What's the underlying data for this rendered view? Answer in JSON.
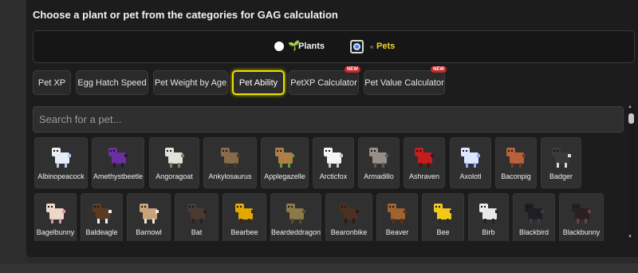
{
  "title": "Choose a plant or pet from the categories for GAG calculation",
  "mode": {
    "plants_label": "Plants",
    "pets_label": "Pets",
    "selected": "Pets"
  },
  "tabs": [
    {
      "label": "Pet XP",
      "badge": ""
    },
    {
      "label": "Egg Hatch Speed",
      "badge": ""
    },
    {
      "label": "Pet Weight by Age",
      "badge": ""
    },
    {
      "label": "Pet Ability",
      "badge": ""
    },
    {
      "label": "PetXP Calculator",
      "badge": "NEW"
    },
    {
      "label": "Pet Value Calculator",
      "badge": "NEW"
    }
  ],
  "active_tab": "Pet Ability",
  "search": {
    "placeholder": "Search for a pet...",
    "value": ""
  },
  "pets_row1": [
    {
      "name": "Albinopeacock",
      "color": "#e8eef5",
      "accent": "#b9c7ff"
    },
    {
      "name": "Amethystbeetle",
      "color": "#6a2fa0",
      "accent": "#2a1440"
    },
    {
      "name": "Angoragoat",
      "color": "#e4e1da",
      "accent": "#8a7a66"
    },
    {
      "name": "Ankylosaurus",
      "color": "#8a6a4c",
      "accent": "#4a3626"
    },
    {
      "name": "Applegazelle",
      "color": "#b07f48",
      "accent": "#5fa03a"
    },
    {
      "name": "Arcticfox",
      "color": "#f4f4f4",
      "accent": "#c9c9c9"
    },
    {
      "name": "Armadillo",
      "color": "#9a8f86",
      "accent": "#5e5752"
    },
    {
      "name": "Ashraven",
      "color": "#c31d1d",
      "accent": "#5a0b0b"
    },
    {
      "name": "Axolotl",
      "color": "#dce8ff",
      "accent": "#8fa9ff"
    },
    {
      "name": "Baconpig",
      "color": "#b8623c",
      "accent": "#7a3a20"
    },
    {
      "name": "Badger",
      "color": "#3a3a3a",
      "accent": "#dcdcdc"
    }
  ],
  "pets_row2": [
    {
      "name": "Bagelbunny",
      "color": "#ecd8c8",
      "accent": "#d49aa8"
    },
    {
      "name": "Baldeagle",
      "color": "#5a3b22",
      "accent": "#f2f2f2"
    },
    {
      "name": "Barnowl",
      "color": "#c9a47a",
      "accent": "#f0e6d6"
    },
    {
      "name": "Bat",
      "color": "#4a3a34",
      "accent": "#2b201c"
    },
    {
      "name": "Bearbee",
      "color": "#e0a800",
      "accent": "#3a2a10"
    },
    {
      "name": "Beardeddragon",
      "color": "#8a7a48",
      "accent": "#5a4e2c"
    },
    {
      "name": "Bearonbike",
      "color": "#4a3020",
      "accent": "#2a1a10"
    },
    {
      "name": "Beaver",
      "color": "#a0622e",
      "accent": "#5a3416"
    },
    {
      "name": "Bee",
      "color": "#f2c81a",
      "accent": "#2a2a2a"
    },
    {
      "name": "Birb",
      "color": "#e9e9e9",
      "accent": "#222"
    },
    {
      "name": "Blackbird",
      "color": "#1e1e26",
      "accent": "#3a3a4a"
    },
    {
      "name": "Blackbunny",
      "color": "#2a2020",
      "accent": "#6a4040"
    }
  ]
}
